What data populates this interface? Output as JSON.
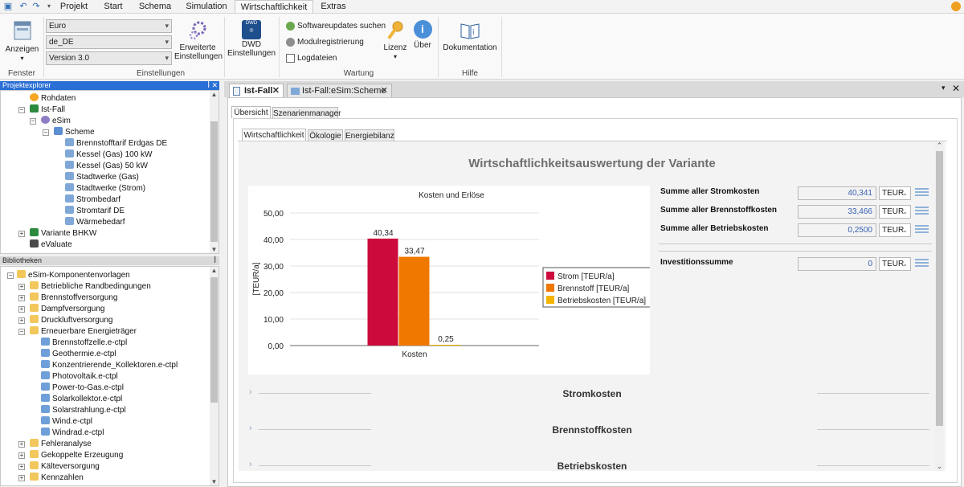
{
  "quick_access": {
    "save_icon": "save-icon",
    "undo_icon": "undo-icon",
    "redo_icon": "redo-icon",
    "dropdown_icon": "quick-access-dropdown-icon"
  },
  "ribbon_tabs": [
    "Projekt",
    "Start",
    "Schema",
    "Simulation",
    "Wirtschaftlichkeit",
    "Extras"
  ],
  "active_ribbon_tab": "Wirtschaftlichkeit",
  "ribbon": {
    "fenster": {
      "anzeigen_label": "Anzeigen",
      "group_label": "Fenster"
    },
    "einstellungen": {
      "currency": "Euro",
      "locale": "de_DE",
      "version": "Version 3.0",
      "erweiterte_label_1": "Erweiterte",
      "erweiterte_label_2": "Einstellungen",
      "dwd_label_1": "DWD",
      "dwd_label_2": "Einstellungen",
      "dwd_icon_text": "DWD",
      "group_label": "Einstellungen"
    },
    "wartung": {
      "softwareupdates": "Softwareupdates suchen",
      "modulregistrierung": "Modulregistrierung",
      "logdateien": "Logdateien",
      "lizenz": "Lizenz",
      "ueber": "Über",
      "group_label": "Wartung"
    },
    "hilfe": {
      "dokumentation": "Dokumentation",
      "group_label": "Hilfe"
    }
  },
  "project_explorer": {
    "title": "Projektexplorer",
    "items": [
      "Rohdaten",
      "Ist-Fall",
      "eSim",
      "Scheme",
      "Brennstofftarif Erdgas DE",
      "Kessel (Gas) 100 kW",
      "Kessel (Gas) 50 kW",
      "Stadtwerke (Gas)",
      "Stadtwerke (Strom)",
      "Strombedarf",
      "Stromtarif DE",
      "Wärmebedarf",
      "Variante BHKW",
      "eValuate"
    ]
  },
  "libraries": {
    "title": "Bibliotheken",
    "items": [
      "eSim-Komponentenvorlagen",
      "Betriebliche Randbedingungen",
      "Brennstoffversorgung",
      "Dampfversorgung",
      "Druckluftversorgung",
      "Erneuerbare Energieträger",
      "Brennstoffzelle.e-ctpl",
      "Geothermie.e-ctpl",
      "Konzentrierende_Kollektoren.e-ctpl",
      "Photovoltaik.e-ctpl",
      "Power-to-Gas.e-ctpl",
      "Solarkollektor.e-ctpl",
      "Solarstrahlung.e-ctpl",
      "Wind.e-ctpl",
      "Windrad.e-ctpl",
      "Fehleranalyse",
      "Gekoppelte Erzeugung",
      "Kälteversorgung",
      "Kennzahlen"
    ]
  },
  "doc_tabs": [
    {
      "label": "Ist-Fall"
    },
    {
      "label": "Ist-Fall:eSim:Scheme"
    }
  ],
  "sub_tabs": [
    "Übersicht",
    "Szenarienmanager"
  ],
  "inner_tabs": [
    "Wirtschaftlichkeit",
    "Ökologie",
    "Energiebilanz"
  ],
  "report": {
    "title": "Wirtschaftlichkeitsauswertung der Variante",
    "summaries": [
      {
        "label": "Summe aller Stromkosten",
        "value": "40,341",
        "unit": "TEUR"
      },
      {
        "label": "Summe aller Brennstoffkosten",
        "value": "33,466",
        "unit": "TEUR"
      },
      {
        "label": "Summe aller Betriebskosten",
        "value": "0,2500",
        "unit": "TEUR"
      },
      {
        "label": "Investitionssumme",
        "value": "0",
        "unit": "TEUR"
      }
    ],
    "sections": [
      "Stromkosten",
      "Brennstoffkosten",
      "Betriebskosten"
    ]
  },
  "chart_data": {
    "type": "bar",
    "title": "Kosten und Erlöse",
    "categories": [
      "Kosten"
    ],
    "xlabel": "",
    "ylabel": "[TEUR/a]",
    "ylim": [
      0,
      50
    ],
    "yticks": [
      "0,00",
      "10,00",
      "20,00",
      "30,00",
      "40,00",
      "50,00"
    ],
    "series": [
      {
        "name": "Strom [TEUR/a]",
        "values": [
          40.34
        ],
        "label": "40,34",
        "color": "#cc0a3c"
      },
      {
        "name": "Brennstoff [TEUR/a]",
        "values": [
          33.47
        ],
        "label": "33,47",
        "color": "#f07800"
      },
      {
        "name": "Betriebskosten [TEUR/a]",
        "values": [
          0.25
        ],
        "label": "0,25",
        "color": "#f5b400"
      }
    ],
    "legend_position": "right",
    "grid": true
  }
}
